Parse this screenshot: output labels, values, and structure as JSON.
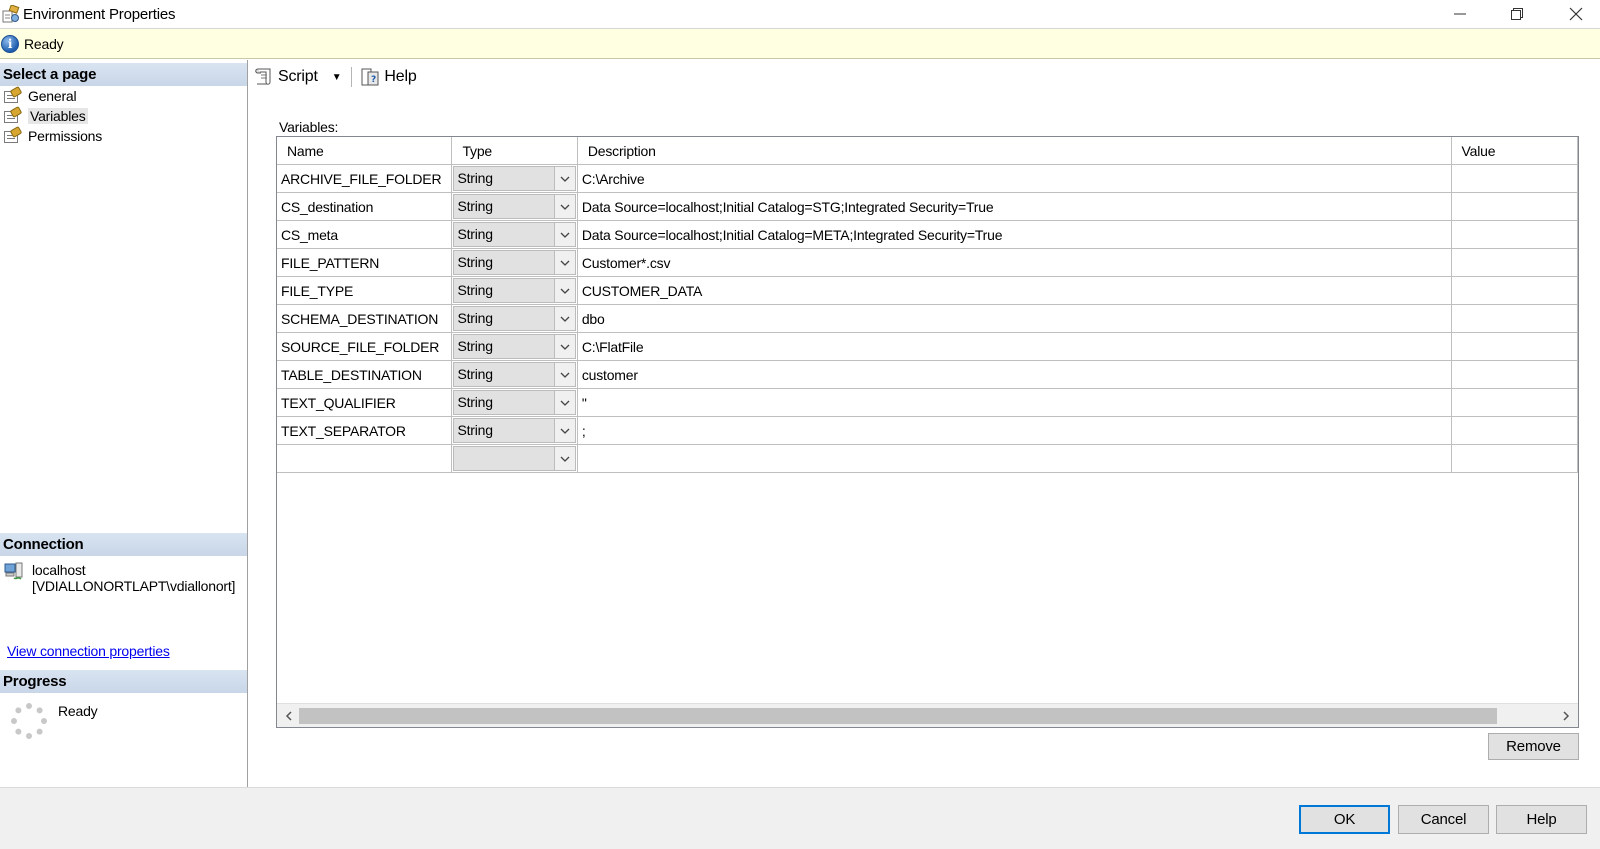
{
  "window": {
    "title": "Environment Properties"
  },
  "status": {
    "text": "Ready"
  },
  "left_pane": {
    "select_page_header": "Select a page",
    "pages": [
      {
        "label": "General"
      },
      {
        "label": "Variables"
      },
      {
        "label": "Permissions"
      }
    ],
    "selected_page": "Variables",
    "connection_header": "Connection",
    "connection_server": "localhost",
    "connection_user": "[VDIALLONORTLAPT\\vdiallonort]",
    "view_connection_link": "View connection properties",
    "progress_header": "Progress",
    "progress_status": "Ready"
  },
  "toolbar": {
    "script_label": "Script",
    "help_label": "Help"
  },
  "variables": {
    "label": "Variables:",
    "columns": [
      "Name",
      "Type",
      "Description",
      "Value"
    ],
    "rows": [
      {
        "name": "ARCHIVE_FILE_FOLDER",
        "type": "String",
        "description": "C:\\Archive",
        "value": ""
      },
      {
        "name": "CS_destination",
        "type": "String",
        "description": "Data Source=localhost;Initial Catalog=STG;Integrated Security=True",
        "value": ""
      },
      {
        "name": "CS_meta",
        "type": "String",
        "description": "Data Source=localhost;Initial Catalog=META;Integrated Security=True",
        "value": ""
      },
      {
        "name": "FILE_PATTERN",
        "type": "String",
        "description": "Customer*.csv",
        "value": ""
      },
      {
        "name": "FILE_TYPE",
        "type": "String",
        "description": "CUSTOMER_DATA",
        "value": ""
      },
      {
        "name": "SCHEMA_DESTINATION",
        "type": "String",
        "description": "dbo",
        "value": ""
      },
      {
        "name": "SOURCE_FILE_FOLDER",
        "type": "String",
        "description": "C:\\FlatFile",
        "value": ""
      },
      {
        "name": "TABLE_DESTINATION",
        "type": "String",
        "description": "customer",
        "value": ""
      },
      {
        "name": "TEXT_QUALIFIER",
        "type": "String",
        "description": "\"",
        "value": ""
      },
      {
        "name": "TEXT_SEPARATOR",
        "type": "String",
        "description": ";",
        "value": ""
      },
      {
        "name": "",
        "type": "",
        "description": "",
        "value": ""
      }
    ]
  },
  "buttons": {
    "remove": "Remove",
    "ok": "OK",
    "cancel": "Cancel",
    "help": "Help"
  },
  "icons": {
    "app": "environment-properties-icon",
    "info": "info-icon",
    "page": "page-properties-icon",
    "connection": "server-connection-icon",
    "spinner": "progress-spinner-icon",
    "script": "script-icon",
    "help": "help-book-icon"
  }
}
